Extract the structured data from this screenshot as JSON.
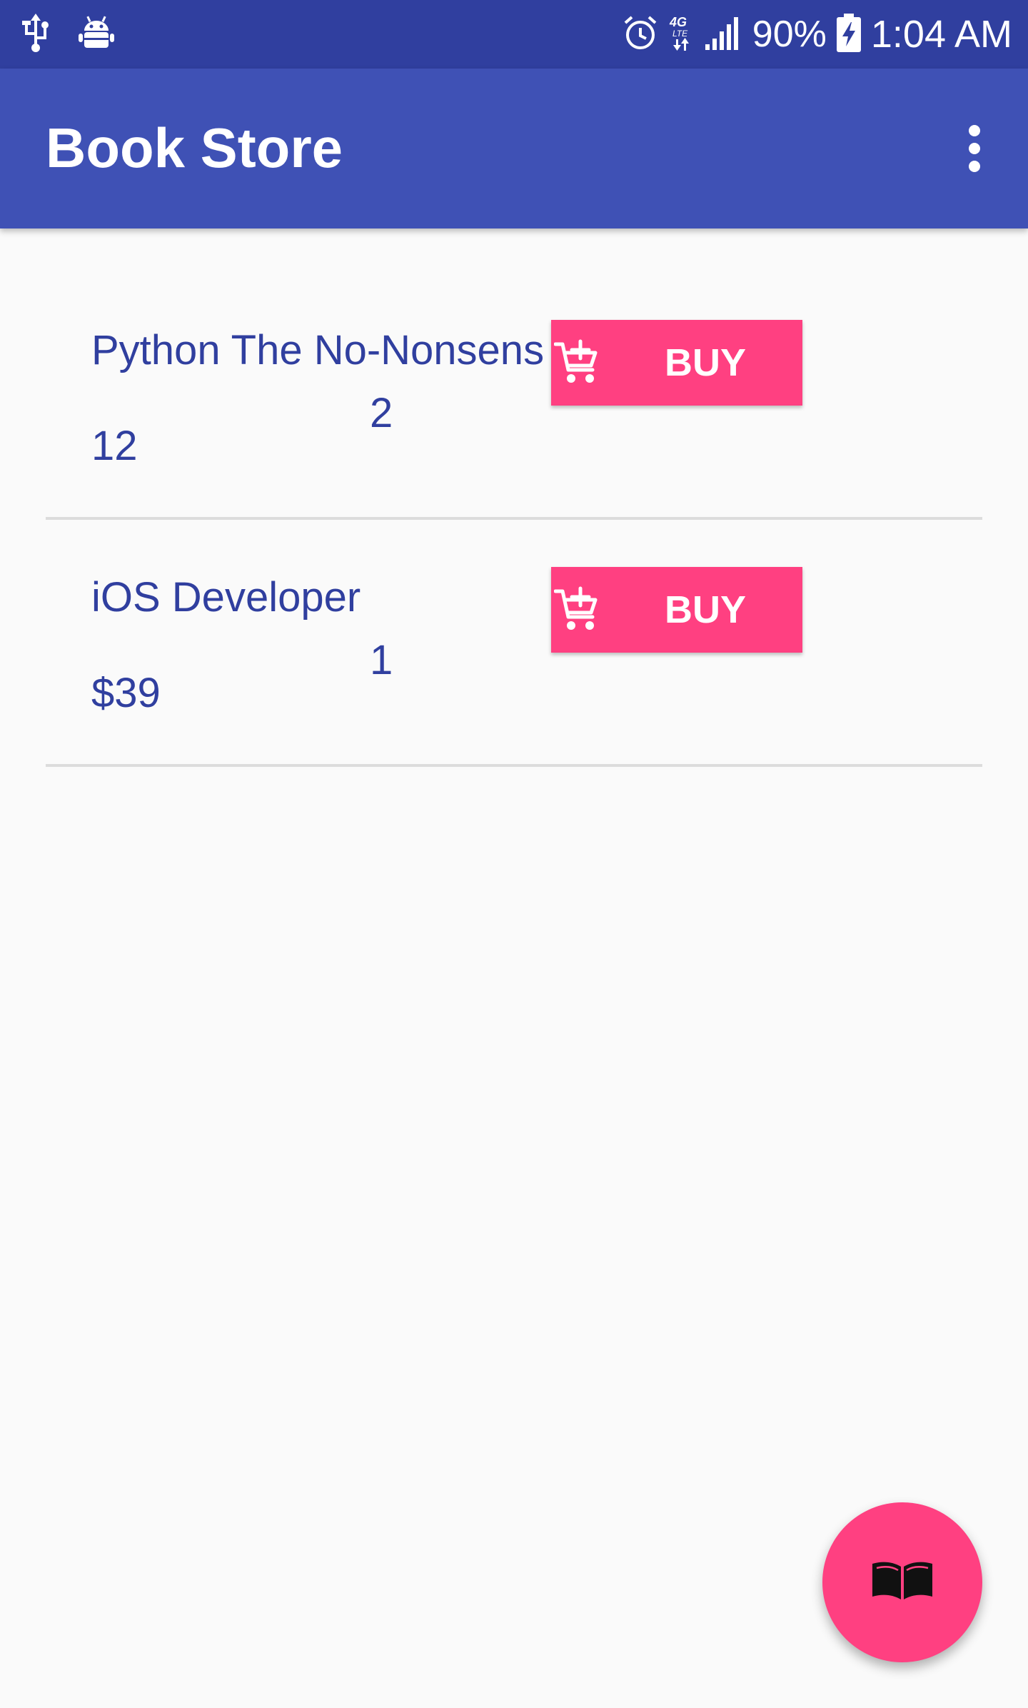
{
  "status_bar": {
    "left_icons": [
      "usb-icon",
      "android-debug-icon"
    ],
    "right_icons": [
      "alarm-icon",
      "4g-lte-icon",
      "signal-icon",
      "battery-charging-icon"
    ],
    "network_label": "4G LTE",
    "battery": "90%",
    "time": "1:04 AM"
  },
  "app_bar": {
    "title": "Book Store",
    "menu_icon": "more-vert-icon"
  },
  "books": [
    {
      "title": "Python The No-Nonsens",
      "quantity": "2",
      "price": "12",
      "buy_label": "BUY",
      "buy_icon": "add-shopping-cart-icon"
    },
    {
      "title": "iOS Developer",
      "quantity": "1",
      "price": "$39",
      "buy_label": "BUY",
      "buy_icon": "add-shopping-cart-icon"
    }
  ],
  "fab": {
    "icon": "book-open-icon"
  },
  "colors": {
    "status_bar": "#303f9f",
    "app_bar": "#3f51b5",
    "accent": "#ff4081",
    "text_primary": "#303f9f",
    "background": "#fafafa",
    "divider": "#dcdcdc"
  }
}
